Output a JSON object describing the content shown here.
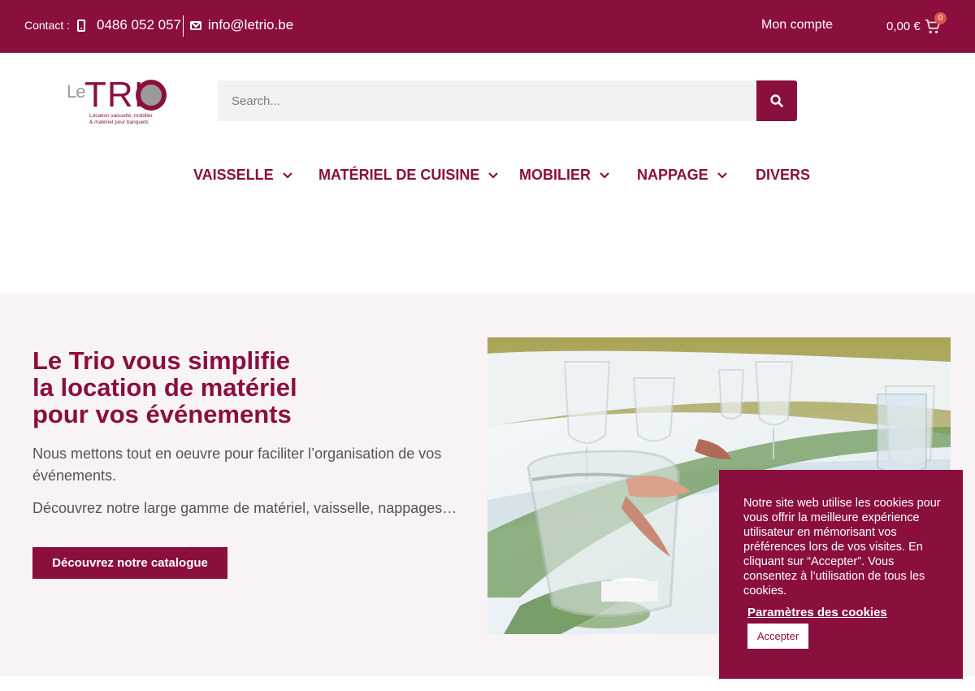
{
  "topbar": {
    "contact_label": "Contact :",
    "phone": "0486 052 057",
    "email": "info@letrio.be",
    "account": "Mon compte",
    "cart_total": "0,00 €",
    "cart_count": "0"
  },
  "logo": {
    "le": "Le",
    "tri": "TRI",
    "tagline": "Location vaisselle, mobilier\n& matériel pour banquets"
  },
  "search": {
    "placeholder": "Search..."
  },
  "nav": {
    "items": [
      {
        "label": "VAISSELLE",
        "has_dropdown": true
      },
      {
        "label": "MATÉRIEL DE CUISINE",
        "has_dropdown": true
      },
      {
        "label": "MOBILIER",
        "has_dropdown": true
      },
      {
        "label": "NAPPAGE",
        "has_dropdown": true
      },
      {
        "label": "DIVERS",
        "has_dropdown": false
      }
    ]
  },
  "hero": {
    "title": "Le Trio vous simplifie\nla location de matériel\npour vos événements",
    "paragraph1": "Nous mettons tout en oeuvre pour faciliter l’organisation de vos événements.",
    "paragraph2": "Découvrez notre large gamme de matériel, vaisselle, nappages…",
    "cta": "Découvrez notre catalogue"
  },
  "cookie": {
    "text": "Notre site web utilise les cookies pour vous offrir la meilleure expérience utilisateur en mémorisant vos préférences lors de vos visites. En cliquant sur “Accepter”. Vous consentez à l’utilisation de tous les cookies.",
    "settings_label": "Paramètres des cookies",
    "accept_label": "Accepter"
  },
  "colors": {
    "brand": "#8a0f3e",
    "hero_bg": "#f8f3f5",
    "badge": "#e0534a"
  }
}
